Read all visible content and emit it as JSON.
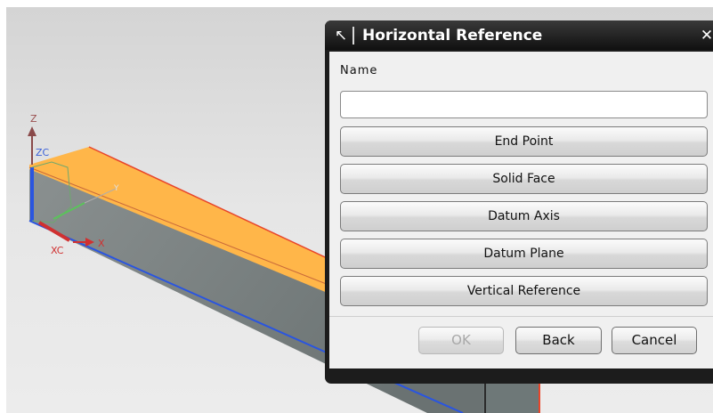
{
  "viewport": {
    "axes": {
      "z_label": "Z",
      "zc_label": "ZC",
      "xc_label": "XC",
      "x_label": "X",
      "y_label": "Y"
    },
    "colors": {
      "top_face": "#ffb649",
      "side_face": "#6b7373",
      "background": "#e6e6e6"
    }
  },
  "dialog": {
    "title": "Horizontal Reference",
    "title_icon": "cursor-arrow-icon",
    "close_glyph": "✕",
    "name_label": "Name",
    "name_value": "",
    "options": [
      {
        "label": "End Point"
      },
      {
        "label": "Solid Face"
      },
      {
        "label": "Datum Axis"
      },
      {
        "label": "Datum Plane"
      },
      {
        "label": "Vertical Reference"
      }
    ],
    "footer": {
      "ok_label": "OK",
      "back_label": "Back",
      "cancel_label": "Cancel"
    }
  }
}
